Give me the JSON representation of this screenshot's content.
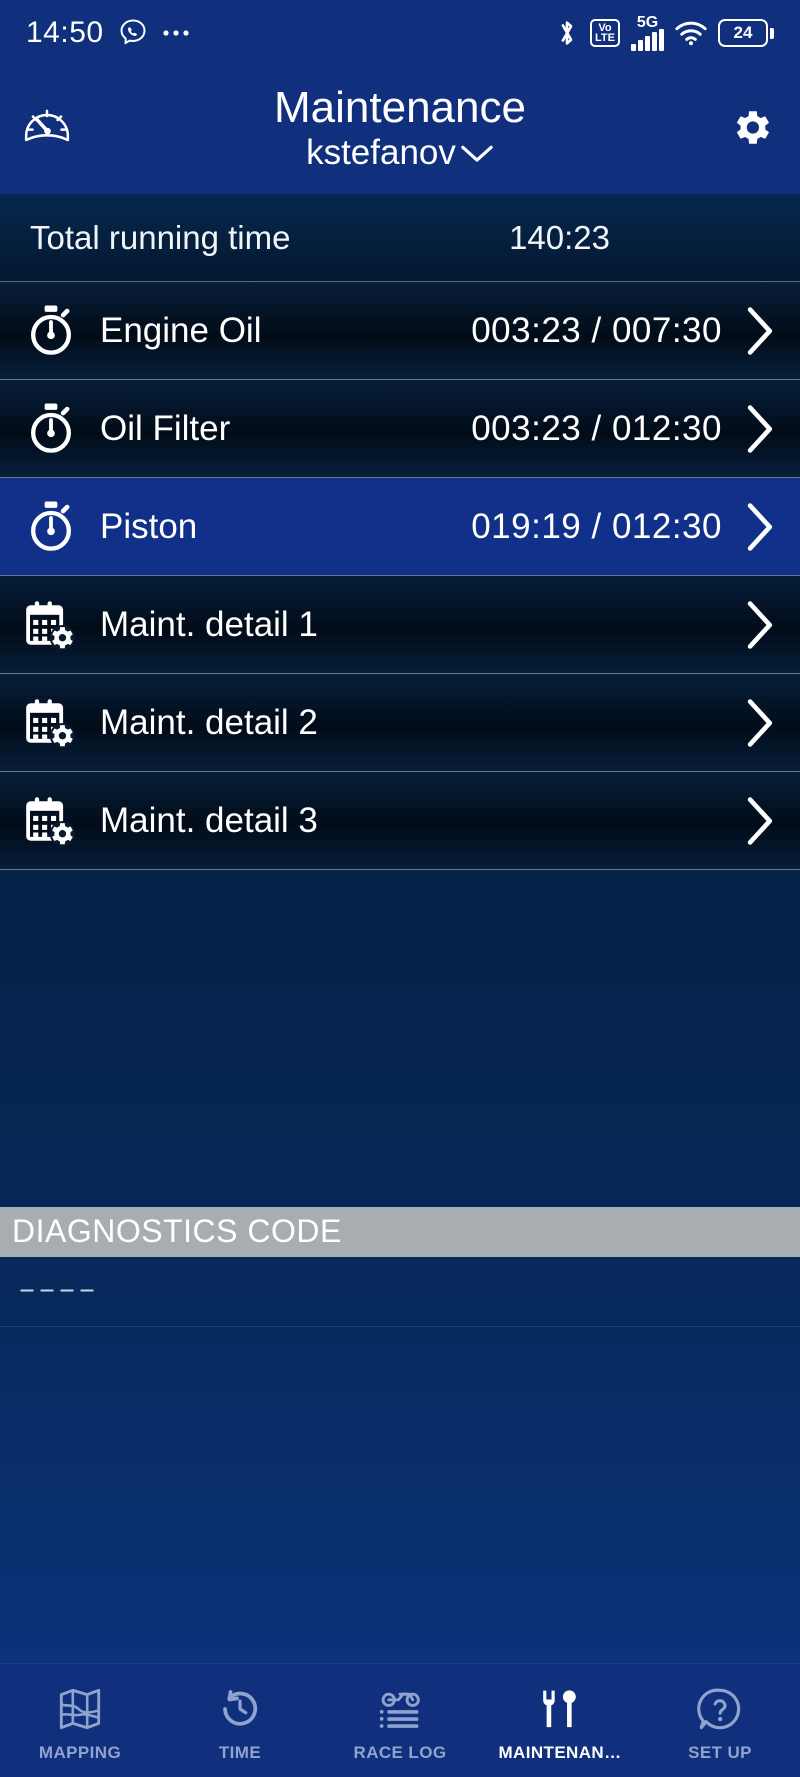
{
  "status_bar": {
    "time": "14:50",
    "left_icons": [
      "viber-icon",
      "more-dots-icon"
    ],
    "right_icons": [
      "bluetooth-icon",
      "volte-icon",
      "5g-signal-icon",
      "wifi-icon",
      "battery-icon"
    ],
    "volte_top": "Vo",
    "volte_bottom": "LTE",
    "network_label": "5G",
    "battery_level": "24"
  },
  "header": {
    "title": "Maintenance",
    "subtitle": "kstefanov",
    "dropdown_icon": "chevron-down-icon",
    "left_icon": "speedometer-icon",
    "right_icon": "gear-icon"
  },
  "total": {
    "label": "Total running time",
    "value": "140:23"
  },
  "items": [
    {
      "icon": "stopwatch-icon",
      "label": "Engine Oil",
      "value": "003:23 / 007:30",
      "selected": false,
      "chevron": "chevron-right-icon"
    },
    {
      "icon": "stopwatch-icon",
      "label": "Oil Filter",
      "value": "003:23 / 012:30",
      "selected": false,
      "chevron": "chevron-right-icon"
    },
    {
      "icon": "stopwatch-icon",
      "label": "Piston",
      "value": "019:19 / 012:30",
      "selected": true,
      "chevron": "chevron-right-icon"
    },
    {
      "icon": "calendar-gear-icon",
      "label": "Maint. detail 1",
      "value": "",
      "selected": false,
      "chevron": "chevron-right-icon"
    },
    {
      "icon": "calendar-gear-icon",
      "label": "Maint. detail 2",
      "value": "",
      "selected": false,
      "chevron": "chevron-right-icon"
    },
    {
      "icon": "calendar-gear-icon",
      "label": "Maint. detail 3",
      "value": "",
      "selected": false,
      "chevron": "chevron-right-icon"
    }
  ],
  "diagnostics": {
    "title": "DIAGNOSTICS CODE",
    "value": "––––"
  },
  "bottom_nav": [
    {
      "icon": "map-icon",
      "label": "MAPPING",
      "active": false
    },
    {
      "icon": "clock-reset-icon",
      "label": "TIME",
      "active": false
    },
    {
      "icon": "motorcycle-list-icon",
      "label": "RACE LOG",
      "active": false
    },
    {
      "icon": "tools-icon",
      "label": "MAINTENAN…",
      "active": true
    },
    {
      "icon": "question-bubble-icon",
      "label": "SET UP",
      "active": false
    }
  ],
  "colors": {
    "header_blue": "#10307e",
    "selected_blue": "#113089",
    "diag_gray": "#a9acb1",
    "nav_inactive": "#8fa3cc",
    "text_white": "#ffffff"
  }
}
